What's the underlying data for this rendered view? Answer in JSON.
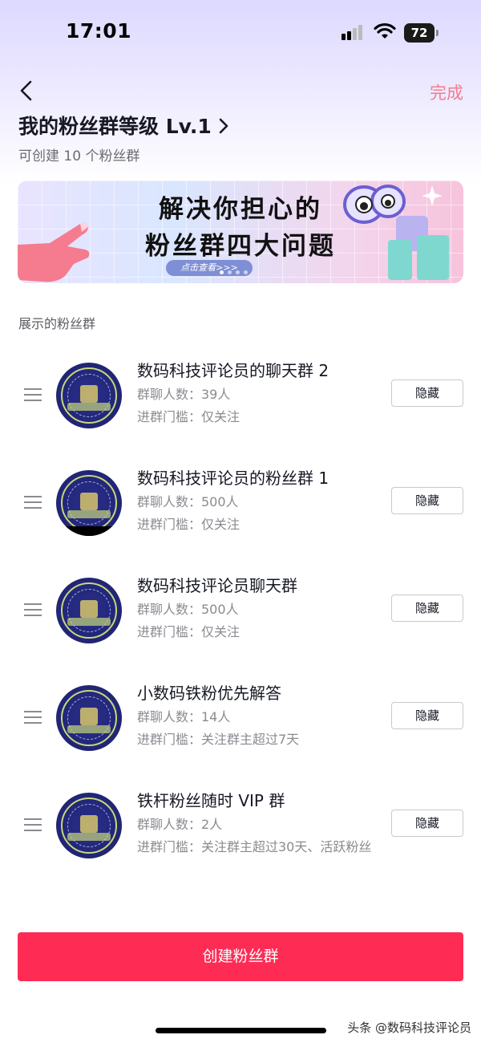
{
  "status_bar": {
    "time": "17:01",
    "battery": "72"
  },
  "nav": {
    "done_label": "完成"
  },
  "header": {
    "title": "我的粉丝群等级 Lv.1",
    "subtitle": "可创建 10 个粉丝群"
  },
  "banner": {
    "line1": "解决你担心的",
    "line2": "粉丝群四大问题",
    "cta": "点击查看>>>"
  },
  "section_label": "展示的粉丝群",
  "groups": [
    {
      "name": "数码科技评论员的聊天群 2",
      "members": "群聊人数：39人",
      "threshold": "进群门槛：仅关注",
      "hide_label": "隐藏"
    },
    {
      "name": "数码科技评论员的粉丝群 1",
      "members": "群聊人数：500人",
      "threshold": "进群门槛：仅关注",
      "hide_label": "隐藏"
    },
    {
      "name": "数码科技评论员聊天群",
      "members": "群聊人数：500人",
      "threshold": "进群门槛：仅关注",
      "hide_label": "隐藏"
    },
    {
      "name": "小数码铁粉优先解答",
      "members": "群聊人数：14人",
      "threshold": "进群门槛：关注群主超过7天",
      "hide_label": "隐藏"
    },
    {
      "name": "铁杆粉丝随时 VIP 群",
      "members": "群聊人数：2人",
      "threshold": "进群门槛：关注群主超过30天、活跃粉丝",
      "hide_label": "隐藏"
    }
  ],
  "create_button": "创建粉丝群",
  "watermark": "头条 @数码科技评论员",
  "colors": {
    "primary": "#fe2c55",
    "done": "#f47c8e",
    "avatar": "#23277a"
  },
  "icons": [
    "back-chevron-icon",
    "chevron-right-icon",
    "drag-handle-icon",
    "wifi-icon",
    "signal-icon",
    "battery-icon"
  ]
}
